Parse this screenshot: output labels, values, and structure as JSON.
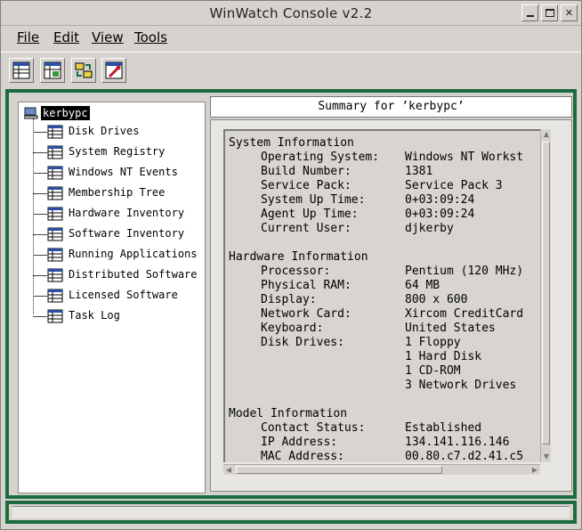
{
  "window": {
    "title": "WinWatch Console v2.2"
  },
  "menu": {
    "items": [
      {
        "label": "File"
      },
      {
        "label": "Edit"
      },
      {
        "label": "View"
      },
      {
        "label": "Tools"
      }
    ]
  },
  "toolbar": {
    "buttons": [
      {
        "icon": "table-view-icon"
      },
      {
        "icon": "table-refresh-icon"
      },
      {
        "icon": "transfer-icon"
      },
      {
        "icon": "settings-tool-icon"
      }
    ]
  },
  "tree": {
    "root_label": "kerbypc",
    "items": [
      {
        "label": "Disk Drives"
      },
      {
        "label": "System Registry"
      },
      {
        "label": "Windows NT Events"
      },
      {
        "label": "Membership Tree"
      },
      {
        "label": "Hardware Inventory"
      },
      {
        "label": "Software Inventory"
      },
      {
        "label": "Running Applications"
      },
      {
        "label": "Distributed Software"
      },
      {
        "label": "Licensed Software"
      },
      {
        "label": "Task Log"
      }
    ]
  },
  "summary": {
    "header": "Summary for ’kerbypc’",
    "sections": [
      {
        "title": "System Information",
        "rows": [
          {
            "key": "Operating System:",
            "value": "Windows NT Workst"
          },
          {
            "key": "Build Number:",
            "value": "1381"
          },
          {
            "key": "Service Pack:",
            "value": "Service Pack 3"
          },
          {
            "key": "System Up Time:",
            "value": "0+03:09:24"
          },
          {
            "key": "Agent Up Time:",
            "value": "0+03:09:24"
          },
          {
            "key": "Current User:",
            "value": "djkerby"
          }
        ]
      },
      {
        "title": "Hardware Information",
        "rows": [
          {
            "key": "Processor:",
            "value": "Pentium (120 MHz)"
          },
          {
            "key": "Physical RAM:",
            "value": "64 MB"
          },
          {
            "key": "Display:",
            "value": "800 x 600"
          },
          {
            "key": "Network Card:",
            "value": "Xircom CreditCard"
          },
          {
            "key": "Keyboard:",
            "value": "United States"
          },
          {
            "key": "Disk Drives:",
            "value": "1 Floppy"
          },
          {
            "key": "",
            "value": "1 Hard Disk"
          },
          {
            "key": "",
            "value": "1 CD-ROM"
          },
          {
            "key": "",
            "value": "3 Network Drives"
          }
        ]
      },
      {
        "title": "Model Information",
        "rows": [
          {
            "key": "Contact Status:",
            "value": "Established"
          },
          {
            "key": "IP Address:",
            "value": "134.141.116.146"
          },
          {
            "key": "MAC Address:",
            "value": "00.80.c7.d2.41.c5"
          }
        ]
      }
    ]
  },
  "status": {
    "text": ""
  },
  "colors": {
    "frame": "#1d6b3f",
    "chrome": "#d6d3ce",
    "selection": "#000000"
  }
}
